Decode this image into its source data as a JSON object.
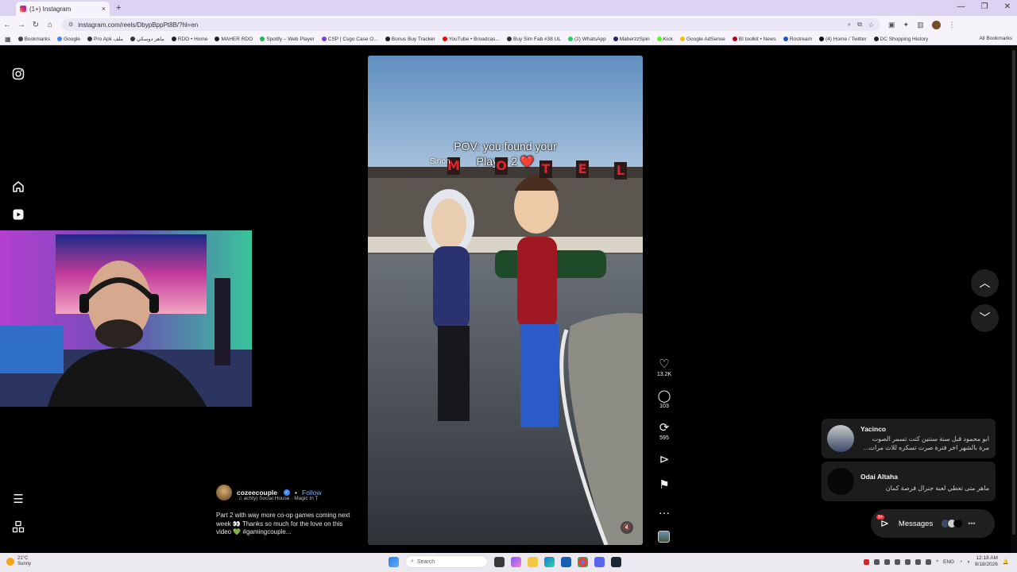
{
  "browser": {
    "tab_title": "(1+) Instagram",
    "url": "instagram.com/reels/DbypBppPt8B/?hl=en",
    "bookmarks": [
      {
        "label": "Bookmarks",
        "color": "#444444"
      },
      {
        "label": "Google",
        "color": "#4285f4"
      },
      {
        "label": "Pro Apk ملف",
        "color": "#333333"
      },
      {
        "label": "ماهر دوسكي",
        "color": "#333333"
      },
      {
        "label": "RDO • Home",
        "color": "#222222"
      },
      {
        "label": "MAHER RDO",
        "color": "#222222"
      },
      {
        "label": "Spotify – Web Player",
        "color": "#1db954"
      },
      {
        "label": "CSP | Csgo Case O...",
        "color": "#7b3fe4"
      },
      {
        "label": "Bonus Buy Tracker",
        "color": "#222222"
      },
      {
        "label": "YouTube • Broadcas...",
        "color": "#ff0000"
      },
      {
        "label": "Buy Sim Fab #38 UL",
        "color": "#333333"
      },
      {
        "label": "(2) WhatsApp",
        "color": "#25d366"
      },
      {
        "label": "MaherzzSpin",
        "color": "#222266"
      },
      {
        "label": "Kick",
        "color": "#53fc18"
      },
      {
        "label": "Google AdSense",
        "color": "#fbbc04"
      },
      {
        "label": "BI toolkit • News",
        "color": "#c00020"
      },
      {
        "label": "Rostream",
        "color": "#2255cc"
      },
      {
        "label": "(4) Home / Twitter",
        "color": "#111111"
      },
      {
        "label": "DC Shopping History",
        "color": "#222222"
      }
    ],
    "all_bookmarks": "All Bookmarks"
  },
  "reel": {
    "caption_line1": "POV: you found your",
    "caption_line2": "Player 2 ❤️",
    "sign_text": "Sinon",
    "motel_letters": [
      "M",
      "O",
      "T",
      "E",
      "L"
    ],
    "likes": "13.2K",
    "comments": "103",
    "reposts": "595",
    "username": "cozeecouple",
    "follow": "Follow",
    "audio": "achty)   Social House · Magic In T",
    "description": "Part 2 with way more co-op games coming next week 👀 Thanks so much for the love on this video 💚 #gamingcouple..."
  },
  "notifications": [
    {
      "name": "Yacinco",
      "message": "ابو محمود قبل سنة سنتين كنت تسمر الصوت مرة بالشهر اخر فترة صرت تسكره للاث مرات..."
    },
    {
      "name": "Odai Altaha",
      "message": "ماهر متى تعطي لعبة جنرال فرصة كمان"
    }
  ],
  "messages": {
    "label": "Messages",
    "badge": "9+"
  },
  "taskbar": {
    "temp": "21°C",
    "weather": "Sunny",
    "search": "Search",
    "lang": "ENG",
    "time": "12:18 AM",
    "date": "8/18/2026"
  },
  "colors": {
    "accent_blue": "#3b8bf5",
    "follow_blue": "#7fb5ff",
    "badge_red": "#ff3040",
    "motel_red": "#e0242c"
  }
}
